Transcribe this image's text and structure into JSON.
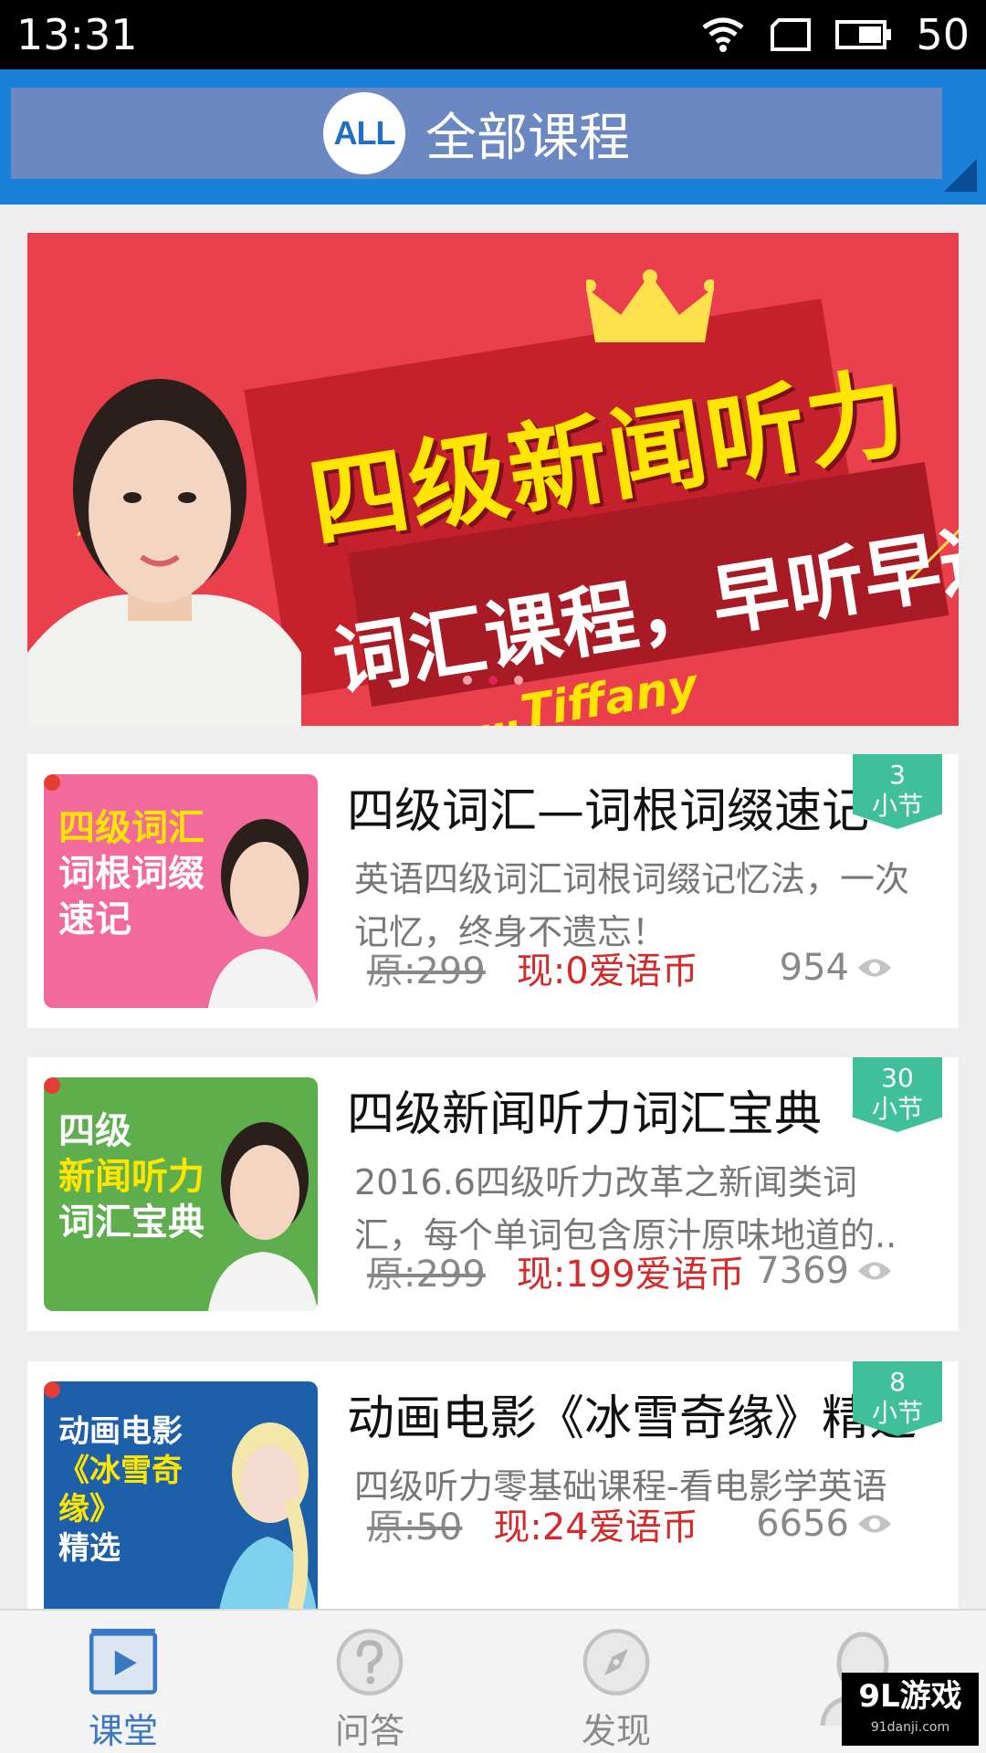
{
  "status_bar": {
    "time": "13:31",
    "battery": "50"
  },
  "header": {
    "badge": "ALL",
    "title": "全部课程"
  },
  "banner": {
    "title": "四级新闻听力",
    "subtitle": "词汇课程，早听早过",
    "author": "…Tiffany",
    "page_count": 3,
    "active_page": 2
  },
  "courses": [
    {
      "thumb_text": "四级词汇\n词根词缀\n速记",
      "title": "四级词汇—词根词缀速记",
      "desc": "英语四级词汇词根词缀记忆法，一次记忆，终身不遗忘！",
      "price_orig": "原:299",
      "price_now": "现:0爱语币",
      "views": "954",
      "lessons": "3",
      "lessons_unit": "小节"
    },
    {
      "thumb_text": "四级\n新闻听力\n词汇宝典",
      "title": "四级新闻听力词汇宝典",
      "desc": "2016.6四级听力改革之新闻类词汇，每个单词包含原汁原味地道的..",
      "price_orig": "原:299",
      "price_now": "现:199爱语币",
      "views": "7369",
      "lessons": "30",
      "lessons_unit": "小节"
    },
    {
      "thumb_text": "动画电影\n《冰雪奇缘》\n精选",
      "title": "动画电影《冰雪奇缘》精选",
      "desc": "四级听力零基础课程-看电影学英语",
      "price_orig": "原:50",
      "price_now": "现:24爱语币",
      "views": "6656",
      "lessons": "8",
      "lessons_unit": "小节"
    }
  ],
  "bottom_nav": [
    {
      "label": "课堂",
      "icon": "play-icon",
      "active": true
    },
    {
      "label": "问答",
      "icon": "question-icon",
      "active": false
    },
    {
      "label": "发现",
      "icon": "compass-icon",
      "active": false
    },
    {
      "label": "",
      "icon": "user-icon",
      "active": false
    }
  ],
  "watermark": {
    "main": "9L游戏",
    "sub": "91danji.com"
  },
  "colors": {
    "header_blue": "#1a7fd8",
    "header_inner": "#6b88c2",
    "price_red": "#d32a2a",
    "badge_green": "#3fbf9a",
    "nav_active": "#3b78c4"
  }
}
